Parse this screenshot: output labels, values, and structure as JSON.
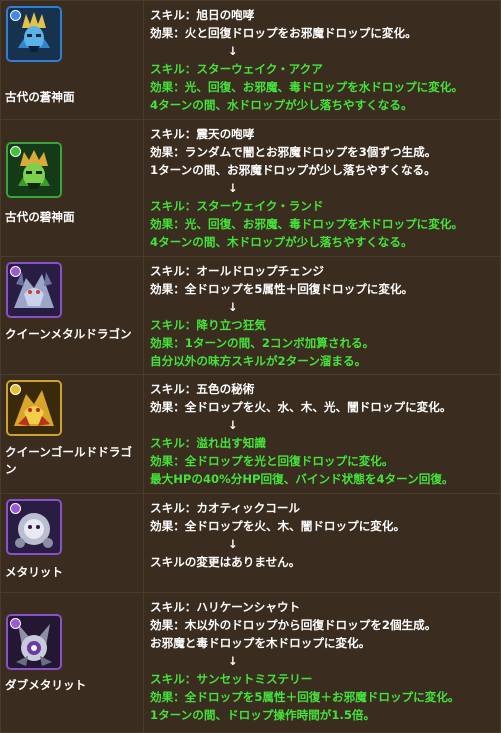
{
  "rows": [
    {
      "name": "古代の蒼神面",
      "icon": "blue-mask-god-icon",
      "frame_color": "#2f7fd4",
      "attr_color": "#3f8ae8",
      "skill_before": "スキル：旭日の咆哮",
      "effect_before": [
        "効果：火と回復ドロップをお邪魔ドロップに変化。"
      ],
      "arrow": "↓",
      "skill_after": "スキル：スターウェイク・アクア",
      "effect_after": [
        "効果：光、回復、お邪魔、毒ドロップを水ドロップに変化。",
        "4ターンの間、水ドロップが少し落ちやすくなる。"
      ]
    },
    {
      "name": "古代の碧神面",
      "icon": "green-mask-god-icon",
      "frame_color": "#3aa53a",
      "attr_color": "#3ec23e",
      "skill_before": "スキル：震天の咆哮",
      "effect_before": [
        "効果：ランダムで闇とお邪魔ドロップを3個ずつ生成。",
        "1ターンの間、お邪魔ドロップが少し落ちやすくなる。"
      ],
      "arrow": "↓",
      "skill_after": "スキル：スターウェイク・ランド",
      "effect_after": [
        "効果：光、回復、お邪魔、毒ドロップを木ドロップに変化。",
        "4ターンの間、木ドロップが少し落ちやすくなる。"
      ]
    },
    {
      "name": "クイーンメタルドラゴン",
      "icon": "metal-dragon-icon",
      "frame_color": "#8a52c8",
      "attr_color": "#9b5bd6",
      "skill_before": "スキル：オールドロップチェンジ",
      "effect_before": [
        "効果：全ドロップを5属性＋回復ドロップに変化。"
      ],
      "arrow": "↓",
      "skill_after": "スキル：降り立つ狂気",
      "effect_after": [
        "効果：1ターンの間、2コンボ加算される。",
        "自分以外の味方スキルが2ターン溜まる。"
      ]
    },
    {
      "name": "クイーンゴールドドラゴン",
      "icon": "gold-dragon-icon",
      "frame_color": "#d1a22a",
      "attr_color": "#e6c02a",
      "skill_before": "スキル：五色の秘術",
      "effect_before": [
        "効果：全ドロップを火、水、木、光、闇ドロップに変化。"
      ],
      "arrow": "↓",
      "skill_after": "スキル：溢れ出す知識",
      "effect_after": [
        "効果：全ドロップを光と回復ドロップに変化。",
        "最大HPの40%分HP回復、バインド状態を4ターン回復。"
      ]
    },
    {
      "name": "メタリット",
      "icon": "metalit-icon",
      "frame_color": "#8a52c8",
      "attr_color": "#9b5bd6",
      "skill_before": "スキル：カオティックコール",
      "effect_before": [
        "効果：全ドロップを火、木、闇ドロップに変化。"
      ],
      "arrow": "↓",
      "skill_after": "",
      "plain_after": "スキルの変更はありません。",
      "effect_after": []
    },
    {
      "name": "ダブメタリット",
      "icon": "dub-metalit-icon",
      "frame_color": "#8a52c8",
      "attr_color": "#9b5bd6",
      "skill_before": "スキル：ハリケーンシャウト",
      "effect_before": [
        "効果：木以外のドロップから回復ドロップを2個生成。",
        "お邪魔と毒ドロップを木ドロップに変化。"
      ],
      "arrow": "↓",
      "skill_after": "スキル：サンセットミステリー",
      "effect_after": [
        "効果：全ドロップを5属性＋回復＋お邪魔ドロップに変化。",
        "1ターンの間、ドロップ操作時間が1.5倍。"
      ]
    }
  ]
}
